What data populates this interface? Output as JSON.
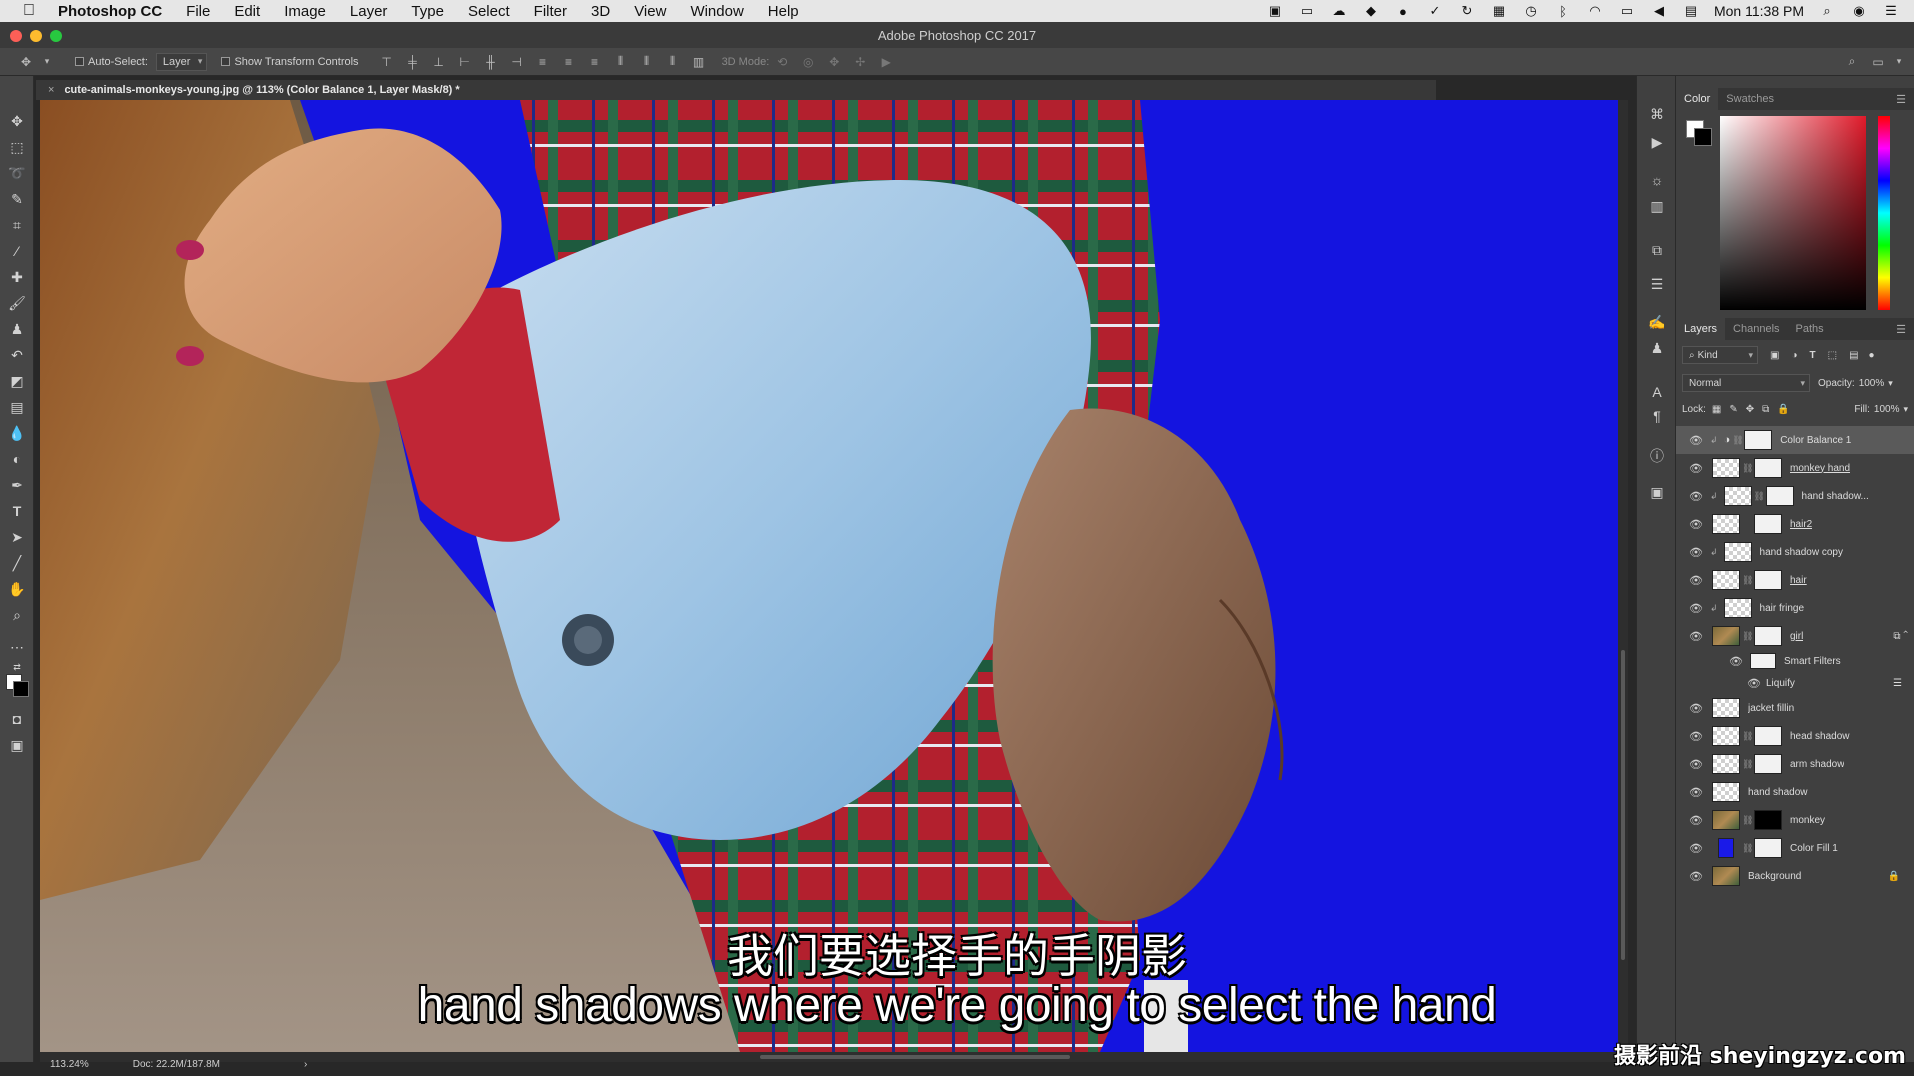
{
  "menubar": {
    "app": "Photoshop CC",
    "items": [
      "File",
      "Edit",
      "Image",
      "Layer",
      "Type",
      "Select",
      "Filter",
      "3D",
      "View",
      "Window",
      "Help"
    ],
    "clock": "Mon 11:38 PM"
  },
  "titlebar": {
    "title": "Adobe Photoshop CC 2017"
  },
  "options": {
    "auto_select_label": "Auto-Select:",
    "auto_select_value": "Layer",
    "transform_label": "Show Transform Controls",
    "mode3d_label": "3D Mode:"
  },
  "document": {
    "tab_title": "cute-animals-monkeys-young.jpg @ 113% (Color Balance 1, Layer Mask/8) *"
  },
  "status": {
    "zoom": "113.24%",
    "doc": "Doc: 22.2M/187.8M"
  },
  "subtitles": {
    "cn": "我们要选择手的手阴影",
    "en": "hand shadows where we're going to select the hand"
  },
  "watermark": "摄影前沿 sheyingzyz.com",
  "color_panel": {
    "tabs": [
      "Color",
      "Swatches"
    ]
  },
  "layers_panel": {
    "tabs": [
      "Layers",
      "Channels",
      "Paths"
    ],
    "filter_kind": "Kind",
    "blend_mode": "Normal",
    "opacity_label": "Opacity:",
    "opacity_value": "100%",
    "lock_label": "Lock:",
    "fill_label": "Fill:",
    "fill_value": "100%",
    "layers": [
      {
        "name": "Color Balance 1"
      },
      {
        "name": "monkey hand"
      },
      {
        "name": "hand shadow..."
      },
      {
        "name": "hair2"
      },
      {
        "name": "hand shadow copy"
      },
      {
        "name": "hair"
      },
      {
        "name": "hair fringe"
      },
      {
        "name": "girl"
      },
      {
        "name": "Smart Filters"
      },
      {
        "name": "Liquify"
      },
      {
        "name": "jacket fillin"
      },
      {
        "name": "head shadow"
      },
      {
        "name": "arm shadow"
      },
      {
        "name": "hand shadow"
      },
      {
        "name": "monkey"
      },
      {
        "name": "Color Fill 1"
      },
      {
        "name": "Background"
      }
    ]
  }
}
